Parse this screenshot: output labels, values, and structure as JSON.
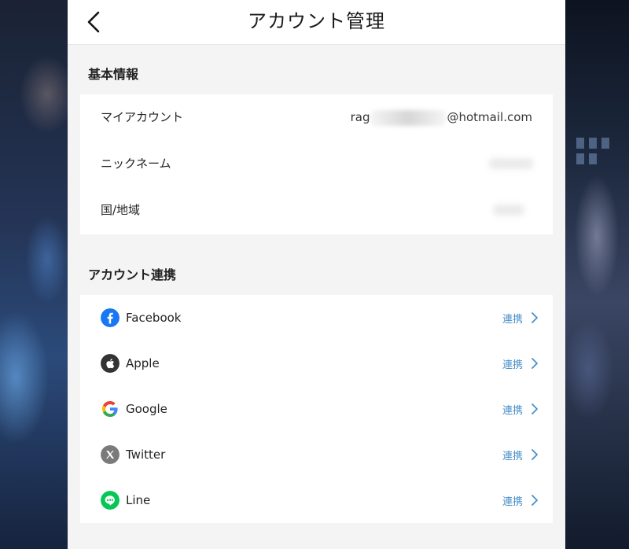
{
  "header": {
    "title": "アカウント管理"
  },
  "basic_info": {
    "section_title": "基本情報",
    "rows": [
      {
        "label": "マイアカウント",
        "value_prefix": "rag",
        "value_suffix": "@hotmail.com"
      },
      {
        "label": "ニックネーム"
      },
      {
        "label": "国/地域"
      }
    ]
  },
  "account_link": {
    "section_title": "アカウント連携",
    "items": [
      {
        "name": "Facebook",
        "action": "連携",
        "icon": "facebook-icon",
        "color": "#1877f2"
      },
      {
        "name": "Apple",
        "action": "連携",
        "icon": "apple-icon",
        "color": "#333333"
      },
      {
        "name": "Google",
        "action": "連携",
        "icon": "google-icon",
        "color": "#4285f4"
      },
      {
        "name": "Twitter",
        "action": "連携",
        "icon": "twitter-x-icon",
        "color": "#7a7a7a"
      },
      {
        "name": "Line",
        "action": "連携",
        "icon": "line-icon",
        "color": "#06c755"
      }
    ]
  },
  "colors": {
    "link_action": "#4a90c8",
    "panel_bg": "#f4f4f4"
  }
}
